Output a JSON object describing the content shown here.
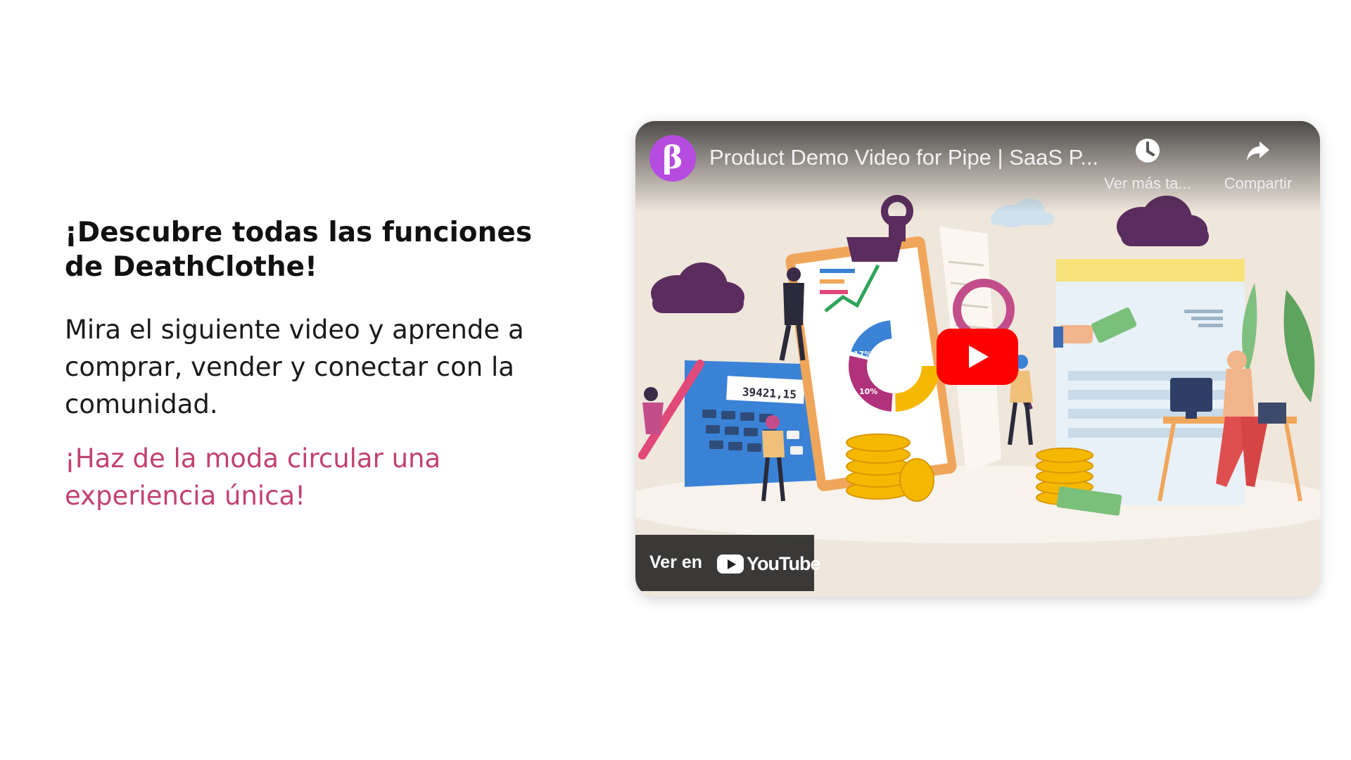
{
  "colors": {
    "accent": "#c2416f",
    "channel_avatar": "#b64be0",
    "play_button": "#ff0000"
  },
  "content": {
    "heading_line1": "¡Descubre todas las funciones",
    "heading_line2": "de DeathClothe!",
    "body": "Mira el siguiente video y aprende a comprar, vender y conectar con la comunidad.",
    "tagline": "¡Haz de la moda circular una experiencia única!"
  },
  "video": {
    "channel_initial": "β",
    "title": "Product Demo Video for Pipe | SaaS P...",
    "watch_later_label": "Ver más ta...",
    "share_label": "Compartir",
    "watch_on_label": "Ver en",
    "youtube_word": "YouTube",
    "thumbnail_number": "39421,15",
    "thumbnail_pct_a": "25%",
    "thumbnail_pct_b": "17%",
    "thumbnail_pct_c": "10%",
    "icons": {
      "watch_later": "clock-icon",
      "share": "share-arrow-icon",
      "play": "play-icon",
      "youtube": "youtube-logo-icon"
    }
  }
}
